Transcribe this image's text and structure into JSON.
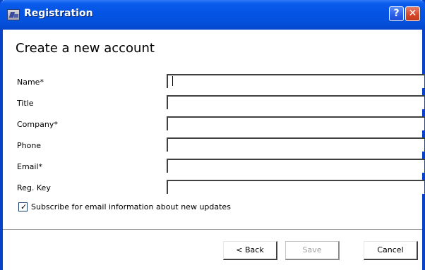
{
  "window": {
    "title": "Registration",
    "help_label": "?",
    "close_label": "✕"
  },
  "form": {
    "heading": "Create a new account",
    "fields": [
      {
        "label": "Name*",
        "value": ""
      },
      {
        "label": "Title",
        "value": ""
      },
      {
        "label": "Company*",
        "value": ""
      },
      {
        "label": "Phone",
        "value": ""
      },
      {
        "label": "Email*",
        "value": ""
      },
      {
        "label": "Reg. Key",
        "value": ""
      }
    ],
    "subscribe": {
      "label": "Subscribe for email information about new updates",
      "checked": true,
      "tick": "✓"
    }
  },
  "buttons": {
    "back": "< Back",
    "save": "Save",
    "cancel": "Cancel"
  },
  "colors": {
    "titlebar": "#0654e4",
    "frame": "#0842c8",
    "close": "#d5452a"
  }
}
